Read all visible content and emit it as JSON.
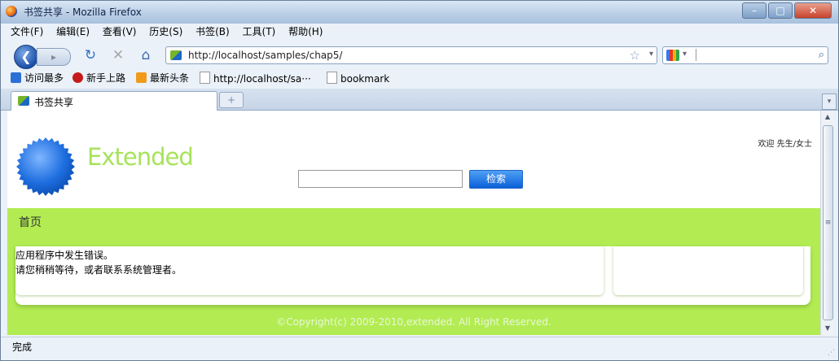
{
  "window": {
    "title": "书签共享 - Mozilla Firefox",
    "controls": {
      "minimize": "–",
      "maximize": "□",
      "close": "✕"
    }
  },
  "menu": [
    "文件(F)",
    "编辑(E)",
    "查看(V)",
    "历史(S)",
    "书签(B)",
    "工具(T)",
    "帮助(H)"
  ],
  "nav": {
    "back": "❮",
    "forward": "▸",
    "url": "http://localhost/samples/chap5/",
    "search_value": ""
  },
  "bookmarks": [
    {
      "label": "访问最多",
      "icon": "most-visited-icon",
      "color": "#2d6fd6"
    },
    {
      "label": "新手上路",
      "icon": "getting-started-icon",
      "color": "#c61b1b"
    },
    {
      "label": "最新头条",
      "icon": "rss-feed-icon",
      "color": "#f09a1c"
    },
    {
      "label": "http://localhost/sa···",
      "icon": "page-icon",
      "color": "#ffffff"
    },
    {
      "label": "bookmark",
      "icon": "page-icon",
      "color": "#ffffff"
    }
  ],
  "tab": {
    "label": "书签共享",
    "new_tab": "+"
  },
  "page": {
    "logo_text": "Extended",
    "greeting": "欢迎  先生/女士",
    "search_placeholder": "",
    "search_button": "检索",
    "home_link": "首页",
    "error_line1": "应用程序中发生错误。",
    "error_line2": "请您稍稍等待，或者联系系统管理者。",
    "footer": "©Copyright(c) 2009-2010,extended. All Right Reserved.",
    "accent_color": "#b2ec52",
    "logo_color": "#1f6fe0"
  },
  "status": {
    "text": "完成"
  }
}
